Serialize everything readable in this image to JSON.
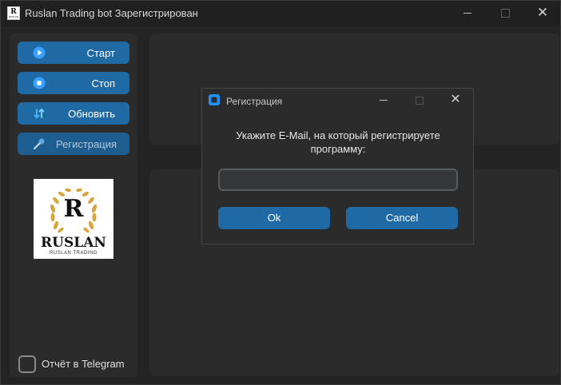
{
  "window": {
    "title": "Ruslan Trading bot Зарегистрирован",
    "icon": "ruslan-logo-icon",
    "controls": [
      "minimize-icon",
      "maximize-icon",
      "close-icon"
    ]
  },
  "sidebar": {
    "buttons": [
      {
        "label": "Старт",
        "icon": "play-icon"
      },
      {
        "label": "Стоп",
        "icon": "stop-icon"
      },
      {
        "label": "Обновить",
        "icon": "refresh-icon"
      },
      {
        "label": "Регистрация",
        "icon": "key-icon"
      }
    ],
    "logo": {
      "letter": "R",
      "name": "RUSLAN",
      "tagline": "RUSLAN TRADING"
    },
    "checkbox": {
      "label": "Отчёт в Telegram",
      "checked": false
    }
  },
  "dialog": {
    "title": "Регистрация",
    "prompt": "Укажите E-Mail, на который регистрируете программу:",
    "email_value": "",
    "email_placeholder": "",
    "ok_label": "Ok",
    "cancel_label": "Cancel"
  },
  "colors": {
    "accent": "#1f6aa5",
    "background": "#242424",
    "panel": "#2b2b2b",
    "logo_gold": "#d9a53a"
  }
}
